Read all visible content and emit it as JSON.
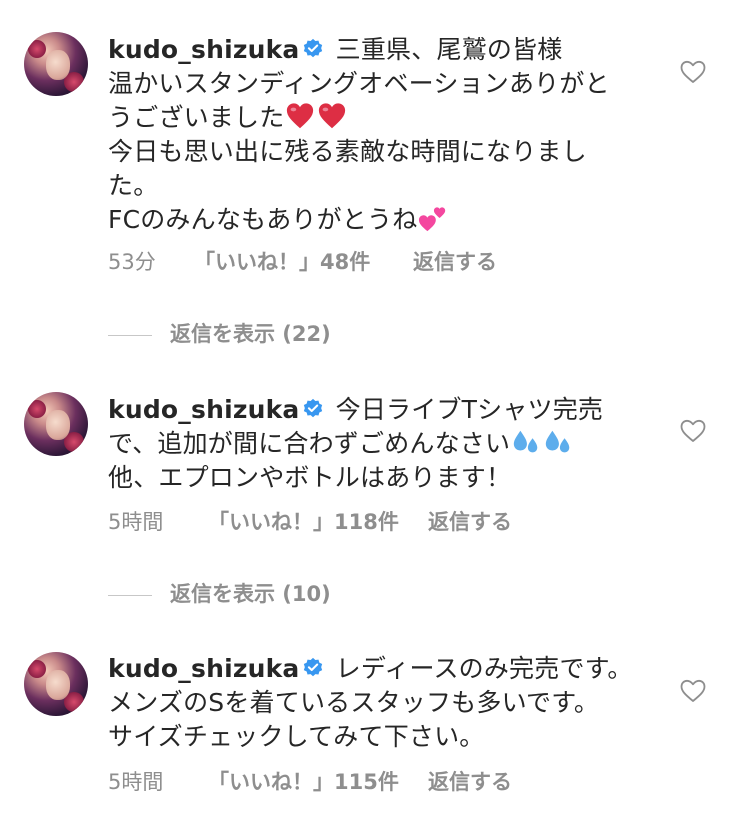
{
  "comments": [
    {
      "username": "kudo_shizuka",
      "lines": [
        "三重県、尾鷲の皆様",
        "温かいスタンディングオベーションありがと",
        "うございました",
        "今日も思い出に残る素敵な時間になりまし",
        "た。",
        "FCのみんなもありがとうね"
      ],
      "time": "53分",
      "likes": "「いいね！」48件",
      "reply": "返信する"
    },
    {
      "username": "kudo_shizuka",
      "lines": [
        "今日ライブTシャツ完売",
        "で、追加が間に合わずごめんなさい",
        "他、エプロンやボトルはあります！"
      ],
      "time": "5時間",
      "likes": "「いいね！」118件",
      "reply": "返信する"
    },
    {
      "username": "kudo_shizuka",
      "lines": [
        "レディースのみ完売です。",
        "メンズのSを着ているスタッフも多いです。",
        "サイズチェックしてみて下さい。"
      ],
      "time": "5時間",
      "likes": "「いいね！」115件",
      "reply": "返信する"
    }
  ],
  "view_replies": [
    "返信を表示 (22)",
    "返信を表示 (10)"
  ],
  "icons": {
    "verified": "verified-badge-icon",
    "like": "heart-outline-icon",
    "red_heart": "red-heart-emoji",
    "two_hearts": "two-hearts-emoji",
    "sweat": "sweat-droplets-emoji"
  },
  "colors": {
    "text": "#262626",
    "secondary": "#8e8e8e",
    "verified": "#3897f0",
    "separator": "#c7c7c7"
  }
}
